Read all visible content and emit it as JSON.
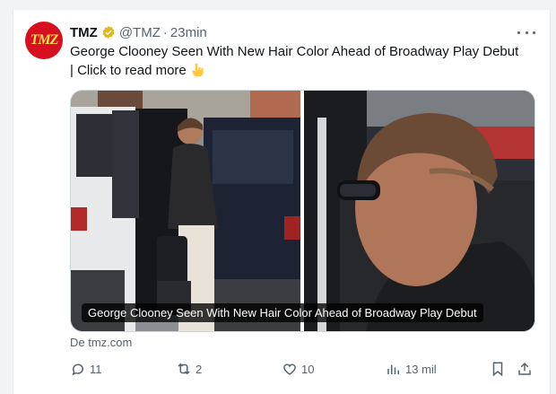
{
  "tweet": {
    "author_name": "TMZ",
    "handle": "@TMZ",
    "separator": "·",
    "time": "23min",
    "avatar_text": "TMZ",
    "text_line1": "George Clooney Seen With New Hair Color Ahead of Broadway Play Debut",
    "text_line2": "| Click to read more",
    "media_caption": "George Clooney Seen With New Hair Color Ahead of Broadway Play Debut",
    "source": "De tmz.com"
  },
  "actions": {
    "replies": "11",
    "retweets": "2",
    "likes": "10",
    "views": "13 mil"
  },
  "icons": [
    "verified-badge-icon",
    "more-icon",
    "pointing-down-icon",
    "reply-icon",
    "retweet-icon",
    "like-icon",
    "views-icon",
    "bookmark-icon",
    "share-icon"
  ],
  "colors": {
    "brand": "#d6101f",
    "verified": "#e2b719",
    "muted": "#536471"
  }
}
